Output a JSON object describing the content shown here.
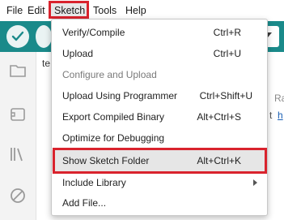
{
  "menubar": {
    "items": [
      {
        "label": "File"
      },
      {
        "label": "Edit"
      },
      {
        "label": "Sketch"
      },
      {
        "label": "Tools"
      },
      {
        "label": "Help"
      }
    ],
    "active": "Sketch"
  },
  "toolbar": {
    "verify_icon": "checkmark-icon",
    "upload_icon": "arrow-right-icon",
    "board_selector_icon": "chevron-down-icon"
  },
  "editor": {
    "tab_label": "te",
    "peek_text_1": "Ra",
    "peek_text_2": "t",
    "peek_link": "h"
  },
  "sketch_menu": {
    "items": [
      {
        "label": "Verify/Compile",
        "shortcut": "Ctrl+R",
        "enabled": true
      },
      {
        "label": "Upload",
        "shortcut": "Ctrl+U",
        "enabled": true
      },
      {
        "label": "Configure and Upload",
        "shortcut": "",
        "enabled": false
      },
      {
        "label": "Upload Using Programmer",
        "shortcut": "Ctrl+Shift+U",
        "enabled": true
      },
      {
        "label": "Export Compiled Binary",
        "shortcut": "Alt+Ctrl+S",
        "enabled": true
      },
      {
        "label": "Optimize for Debugging",
        "shortcut": "",
        "enabled": true
      },
      {
        "label": "Show Sketch Folder",
        "shortcut": "Alt+Ctrl+K",
        "enabled": true,
        "highlighted": true
      },
      {
        "label": "Include Library",
        "shortcut": "",
        "enabled": true,
        "submenu": true
      },
      {
        "label": "Add File...",
        "shortcut": "",
        "enabled": true
      }
    ]
  },
  "colors": {
    "toolbar_bg": "#1a8a8a",
    "highlight_border": "#d9232d",
    "menu_bg": "#ffffff"
  }
}
